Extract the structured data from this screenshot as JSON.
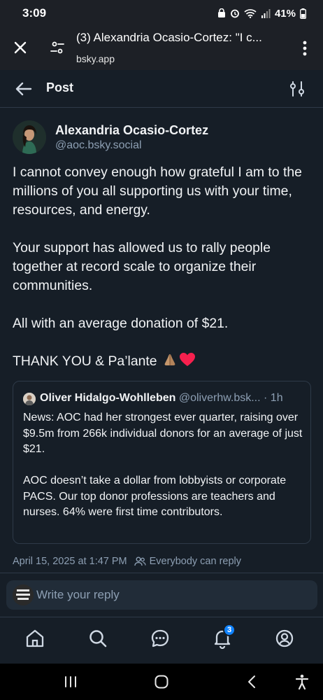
{
  "status_bar": {
    "time": "3:09",
    "battery": "41%"
  },
  "browser": {
    "tab_title": "(3) Alexandria Ocasio-Cortez: \"I c...",
    "url": "bsky.app"
  },
  "header": {
    "title": "Post"
  },
  "post": {
    "author_name": "Alexandria Ocasio-Cortez",
    "author_handle": "@aoc.bsky.social",
    "paragraphs": [
      "I cannot convey enough how grateful I am to the millions of you all supporting us with your time, resources, and energy.",
      "Your support has allowed us to rally people together at record scale to organize their communities.",
      "All with an average donation of $21.",
      "THANK YOU & Pa’lante"
    ],
    "timestamp": "April 15, 2025 at 1:47 PM",
    "reply_setting": "Everybody can reply"
  },
  "quote": {
    "author_name": "Oliver Hidalgo-Wohlleben",
    "author_handle": "@oliverhw.bsk...",
    "age": "· 1h",
    "paragraphs": [
      "News: AOC had her strongest ever quarter, raising over $9.5m from 266k individual donors for an average of just $21.",
      "AOC doesn’t take a dollar from lobbyists or corporate PACS. Our top donor professions are teachers and nurses. 64% were first time contributors."
    ]
  },
  "reply_box": {
    "placeholder": "Write your reply"
  },
  "tabs": [
    {
      "icon": "home-icon"
    },
    {
      "icon": "search-icon"
    },
    {
      "icon": "chat-icon"
    },
    {
      "icon": "bell-icon",
      "badge": "3"
    },
    {
      "icon": "profile-icon"
    }
  ],
  "colors": {
    "background": "#161e27",
    "border": "#2e3a48",
    "muted_text": "#8d9fb3",
    "accent": "#1083fe"
  }
}
